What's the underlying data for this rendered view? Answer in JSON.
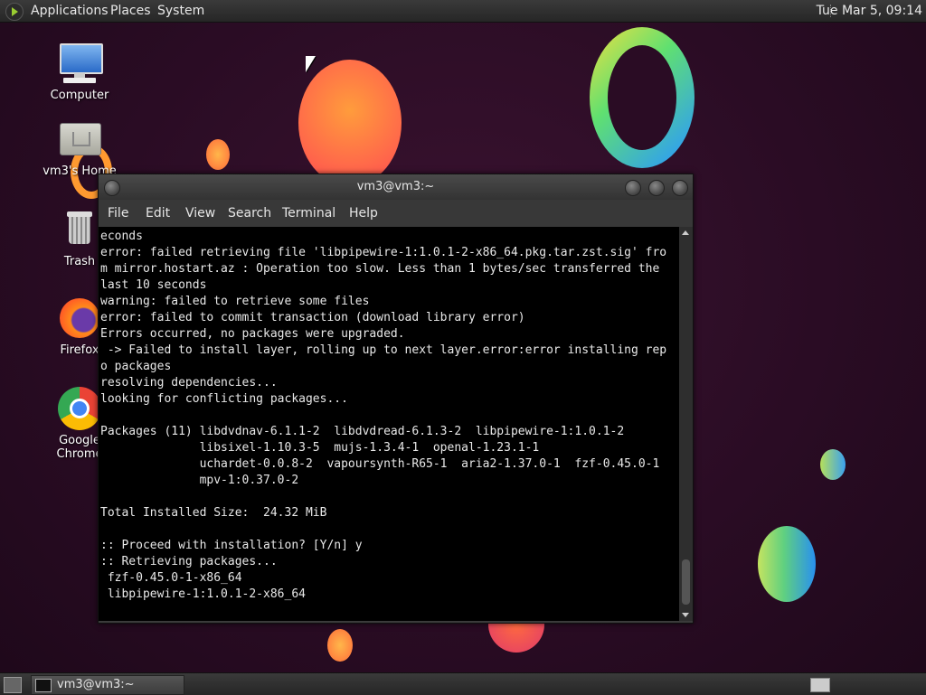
{
  "top_panel": {
    "menus": [
      "Applications",
      "Places",
      "System"
    ],
    "clock": "Tue Mar  5, 09:14",
    "logo_icon": "distro-menu-icon"
  },
  "desktop_icons": [
    {
      "label": "Computer",
      "icon": "computer-icon"
    },
    {
      "label": "vm3's Home",
      "icon": "home-folder-icon"
    },
    {
      "label": "Trash",
      "icon": "trash-icon"
    },
    {
      "label": "Firefox",
      "icon": "firefox-icon"
    },
    {
      "label": "Google Chrome",
      "icon": "chrome-icon"
    }
  ],
  "terminal": {
    "title": "vm3@vm3:~",
    "menu": [
      "File",
      "Edit",
      "View",
      "Search",
      "Terminal",
      "Help"
    ],
    "lines": [
      "econds",
      "error: failed retrieving file 'libpipewire-1:1.0.1-2-x86_64.pkg.tar.zst.sig' fro",
      "m mirror.hostart.az : Operation too slow. Less than 1 bytes/sec transferred the",
      "last 10 seconds",
      "warning: failed to retrieve some files",
      "error: failed to commit transaction (download library error)",
      "Errors occurred, no packages were upgraded.",
      " -> Failed to install layer, rolling up to next layer.error:error installing rep",
      "o packages",
      "resolving dependencies...",
      "looking for conflicting packages...",
      "",
      "Packages (11) libdvdnav-6.1.1-2  libdvdread-6.1.3-2  libpipewire-1:1.0.1-2",
      "              libsixel-1.10.3-5  mujs-1.3.4-1  openal-1.23.1-1",
      "              uchardet-0.0.8-2  vapoursynth-R65-1  aria2-1.37.0-1  fzf-0.45.0-1",
      "              mpv-1:0.37.0-2",
      "",
      "Total Installed Size:  24.32 MiB",
      "",
      ":: Proceed with installation? [Y/n] y",
      ":: Retrieving packages...",
      " fzf-0.45.0-1-x86_64",
      " libpipewire-1:1.0.1-2-x86_64"
    ]
  },
  "bottom_panel": {
    "task_label": "vm3@vm3:~"
  },
  "colors": {
    "desktop_bg": "#2a0c24",
    "terminal_bg": "#000000",
    "panel_bg": "#2e2e2e"
  }
}
